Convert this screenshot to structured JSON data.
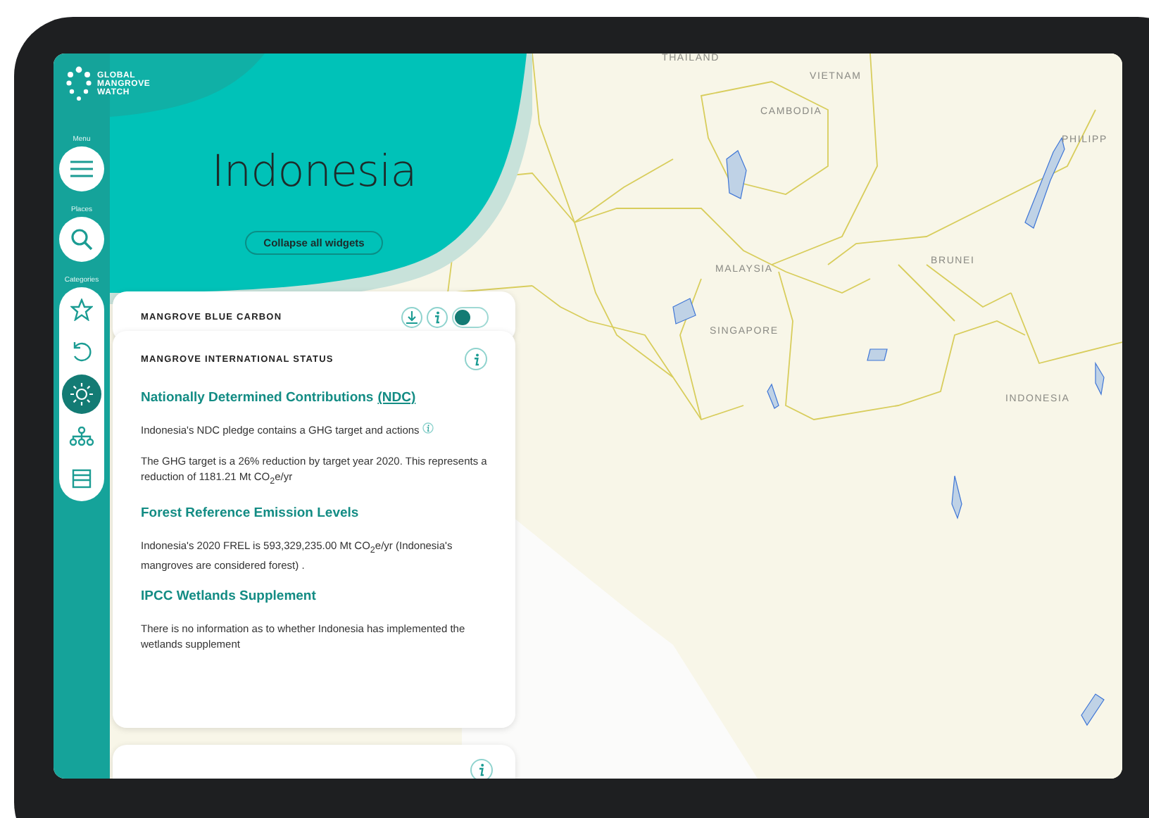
{
  "logo": {
    "lines": [
      "GLOBAL",
      "MANGROVE",
      "WATCH"
    ]
  },
  "sidebar": {
    "menu_label": "Menu",
    "places_label": "Places",
    "categories_label": "Categories",
    "categories": [
      {
        "selected": false
      },
      {
        "selected": false
      },
      {
        "selected": true
      },
      {
        "selected": false
      },
      {
        "selected": false
      }
    ]
  },
  "header": {
    "title": "Indonesia",
    "collapse_button": "Collapse all widgets"
  },
  "widgets": [
    {
      "title": "MANGROVE BLUE CARBON",
      "toggle": {
        "on": false
      }
    },
    {
      "title": "MANGROVE INTERNATIONAL STATUS",
      "sections": [
        {
          "heading": "Nationally Determined Contributions",
          "heading_link": "(NDC)",
          "paragraphs": [
            {
              "text": "Indonesia's NDC pledge contains a GHG target and actions",
              "info": true
            },
            {
              "text": "The GHG target is a 26% reduction by target year 2020. This represents a reduction of 1181.21 Mt CO$_{2}$e/yr",
              "info": false
            }
          ]
        },
        {
          "heading": "Forest Reference Emission Levels",
          "paragraphs": [
            {
              "text": "Indonesia's 2020 FREL is 593,329,235.00 Mt CO$_{2}$e/yr (Indonesia's mangroves are considered forest) .",
              "info": false
            }
          ]
        },
        {
          "heading": "IPCC Wetlands Supplement",
          "paragraphs": [
            {
              "text": "There is no information as to whether Indonesia has implemented the wetlands supplement",
              "info": false
            }
          ]
        }
      ]
    }
  ],
  "map": {
    "labels": [
      "THAILAND",
      "VIETNAM",
      "CAMBODIA",
      "PHILIPP",
      "MALAYSIA",
      "SINGAPORE",
      "BRUNEI",
      "INDONESIA"
    ]
  }
}
